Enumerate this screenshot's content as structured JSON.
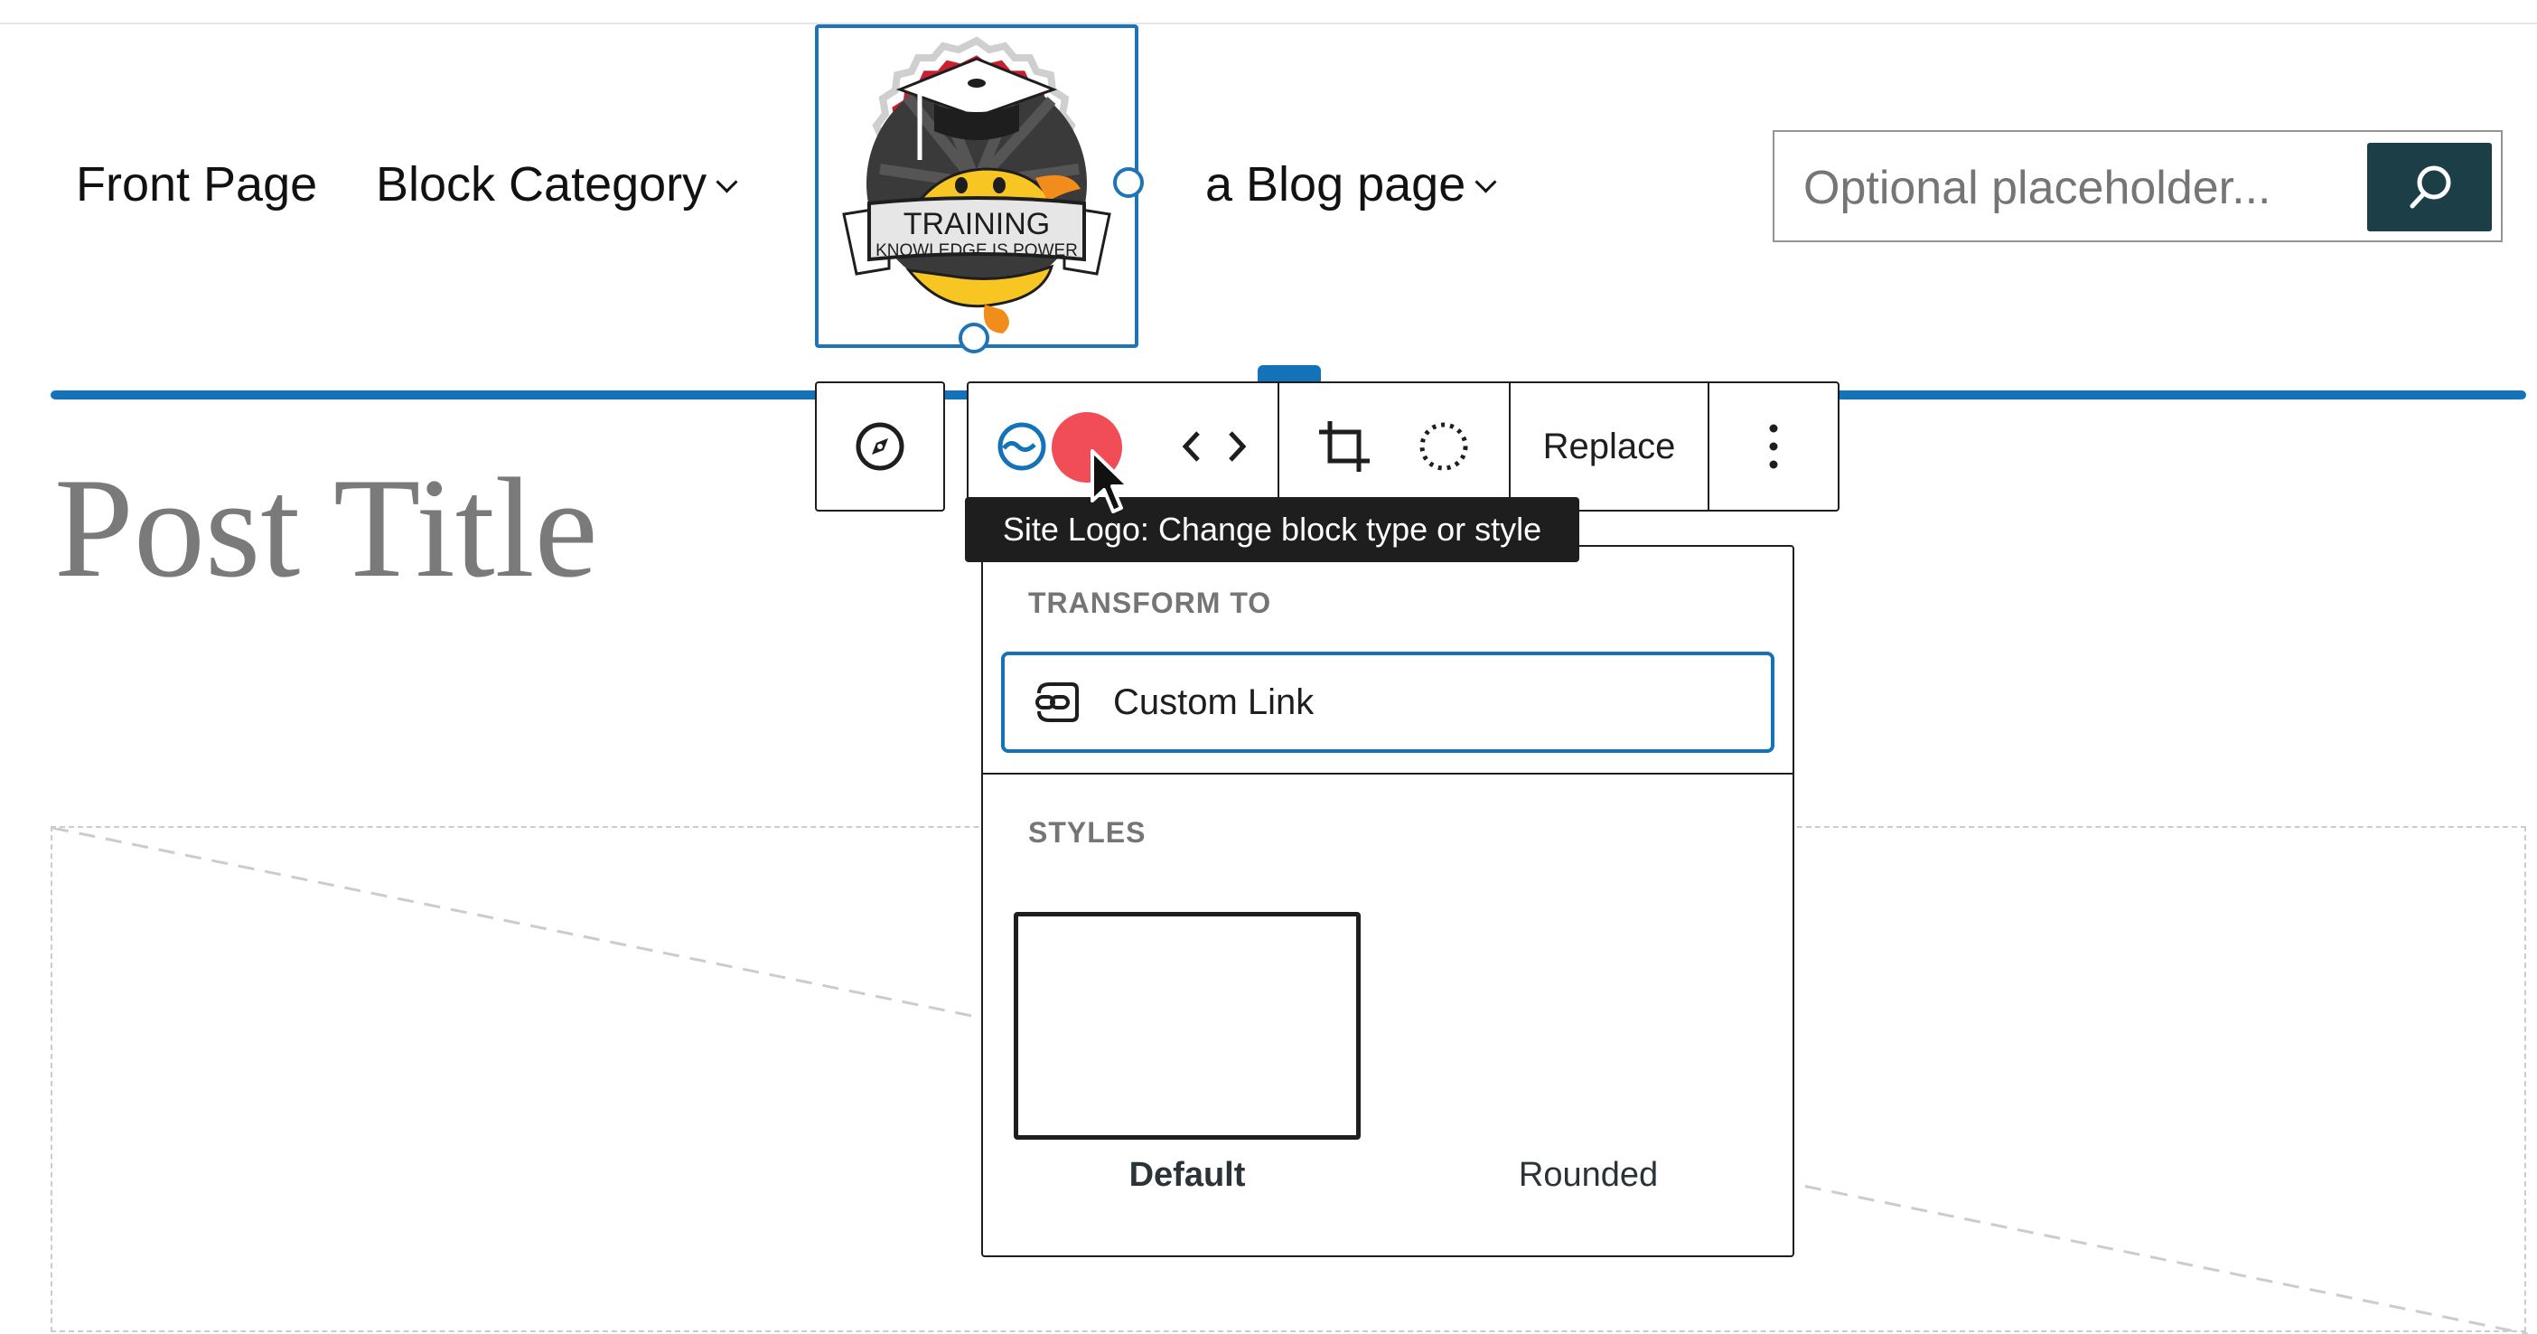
{
  "nav": {
    "items": [
      {
        "label": "Front Page",
        "has_submenu": false
      },
      {
        "label": "Block Category",
        "has_submenu": true
      },
      {
        "label": "a Blog page",
        "has_submenu": true
      }
    ]
  },
  "logo": {
    "title": "TRAINING",
    "tagline": "KNOWLEDGE IS POWER",
    "colors": {
      "ring": "#c8202f",
      "badge": "#3a3a3a",
      "mascot": "#f7c623",
      "tail": "#f28c1b"
    }
  },
  "search": {
    "placeholder": "Optional placeholder...",
    "button_icon": "search-icon",
    "button_color": "#1c3f47"
  },
  "toolbar": {
    "buttons": [
      {
        "name": "parent-select-button",
        "icon": "compass-icon"
      },
      {
        "name": "block-type-button",
        "icon": "site-logo-icon"
      },
      {
        "name": "move-left-button",
        "icon": "chevron-left-icon"
      },
      {
        "name": "move-right-button",
        "icon": "chevron-right-icon"
      },
      {
        "name": "crop-button",
        "icon": "crop-icon"
      },
      {
        "name": "circle-crop-button",
        "icon": "dotted-circle-icon"
      },
      {
        "name": "more-options-button",
        "icon": "kebab-icon"
      }
    ],
    "replace_label": "Replace"
  },
  "post": {
    "title": "Post Title"
  },
  "tooltip": {
    "text": "Site Logo: Change block type or style"
  },
  "dropdown": {
    "transform_heading": "TRANSFORM TO",
    "transform_options": [
      {
        "label": "Custom Link",
        "icon": "custom-link-icon"
      }
    ],
    "styles_heading": "STYLES",
    "styles": [
      {
        "label": "Default",
        "selected": true
      },
      {
        "label": "Rounded",
        "selected": false
      }
    ]
  },
  "theme": {
    "accent": "#1473b8",
    "cursor_highlight": "#f0434e"
  }
}
